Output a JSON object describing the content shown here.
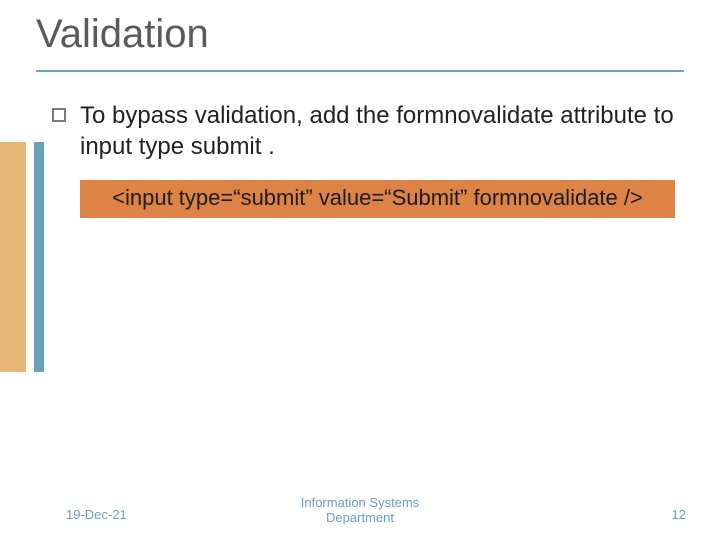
{
  "title": "Validation",
  "bullet": {
    "text": "To bypass validation, add the formnovalidate attribute to input type submit ."
  },
  "code_snippet": "<input type=“submit” value=“Submit” formnovalidate />",
  "footer": {
    "date": "19-Dec-21",
    "department_line1": "Information Systems",
    "department_line2": "Department",
    "page_number": "12"
  },
  "colors": {
    "accent_blue": "#6aa0b8",
    "accent_gold": "#e8b777",
    "code_bg": "#de8346"
  }
}
